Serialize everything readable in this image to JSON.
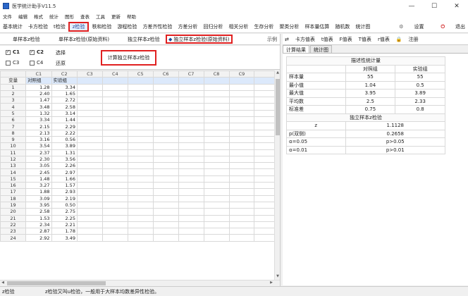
{
  "window": {
    "title": "医学统计助手V11.5",
    "minimize": "—",
    "maximize": "☐",
    "close": "✕"
  },
  "menu": [
    "文件",
    "编辑",
    "格式",
    "统计",
    "图形",
    "查表",
    "工具",
    "更新",
    "帮助"
  ],
  "toolbar": {
    "items": [
      "基本统计",
      "卡方检验",
      "t检验",
      "z检验",
      "秩和检验",
      "游程检验",
      "方差齐性检验",
      "方差分析",
      "回归分析",
      "相关分析",
      "生存分析",
      "聚类分析",
      "样本量估算",
      "随机数",
      "统计图"
    ],
    "active_index": 3,
    "settings": "设置",
    "exit": "退出"
  },
  "subtabs": {
    "items": [
      "单样本z检验",
      "单样本z检验(原始资料)",
      "独立样本z检验",
      "独立样本z检验(原始资料)"
    ],
    "active_index": 3,
    "example": "示例"
  },
  "vars": {
    "checkboxes": [
      {
        "label": "C1",
        "checked": true
      },
      {
        "label": "C2",
        "checked": true
      },
      {
        "label": "C3",
        "checked": false
      },
      {
        "label": "C4",
        "checked": false
      }
    ],
    "select_label": "选择",
    "restore_label": "还原",
    "calc_button": "计算独立样本z检验"
  },
  "grid": {
    "columns": [
      "",
      "C1",
      "C2",
      "C3",
      "C4",
      "C5",
      "C6",
      "C7",
      "C8",
      "C9"
    ],
    "label_row": [
      "变量",
      "对照组",
      "实验组"
    ],
    "rows": [
      [
        "1",
        "1.28",
        "3.34"
      ],
      [
        "2",
        "2.40",
        "1.65"
      ],
      [
        "3",
        "1.47",
        "2.72"
      ],
      [
        "4",
        "3.48",
        "2.58"
      ],
      [
        "5",
        "1.32",
        "3.14"
      ],
      [
        "6",
        "3.34",
        "1.44"
      ],
      [
        "7",
        "2.15",
        "2.29"
      ],
      [
        "8",
        "2.13",
        "2.22"
      ],
      [
        "9",
        "3.16",
        "0.56"
      ],
      [
        "10",
        "3.54",
        "3.89"
      ],
      [
        "11",
        "2.37",
        "1.31"
      ],
      [
        "12",
        "2.30",
        "3.56"
      ],
      [
        "13",
        "3.05",
        "2.26"
      ],
      [
        "14",
        "2.45",
        "2.97"
      ],
      [
        "15",
        "1.48",
        "1.66"
      ],
      [
        "16",
        "3.27",
        "1.57"
      ],
      [
        "17",
        "1.88",
        "2.93"
      ],
      [
        "18",
        "3.09",
        "2.19"
      ],
      [
        "19",
        "3.95",
        "0.50"
      ],
      [
        "20",
        "2.58",
        "2.75"
      ],
      [
        "21",
        "1.53",
        "2.25"
      ],
      [
        "22",
        "2.34",
        "2.21"
      ],
      [
        "23",
        "2.87",
        "1.78"
      ],
      [
        "24",
        "2.92",
        "3.49"
      ]
    ]
  },
  "right": {
    "swap_icon": "⇄",
    "tools": [
      "卡方值表",
      "t值表",
      "F值表",
      "T值表",
      "r值表",
      "注册"
    ],
    "tabs": [
      "计算结果",
      "统计图"
    ],
    "active_tab": 0,
    "desc_title": "描述性统计量",
    "desc_headers": [
      "",
      "对照组",
      "实验组"
    ],
    "desc_rows": [
      [
        "样本量",
        "55",
        "55"
      ],
      [
        "最小值",
        "1.04",
        "0.5"
      ],
      [
        "最大值",
        "3.95",
        "3.89"
      ],
      [
        "平均数",
        "2.5",
        "2.33"
      ],
      [
        "标准差",
        "0.75",
        "0.8"
      ]
    ],
    "test_title": "独立样本z检验",
    "test_rows": [
      [
        "z",
        "1.1128"
      ],
      [
        "p(双侧)",
        "0.2658"
      ],
      [
        "α=0.05",
        "p>0.05"
      ],
      [
        "α=0.01",
        "p>0.01"
      ]
    ]
  },
  "status": {
    "left": "z检验",
    "message": "z检验又叫u检验，一般用于大样本均数差异性检验。"
  }
}
